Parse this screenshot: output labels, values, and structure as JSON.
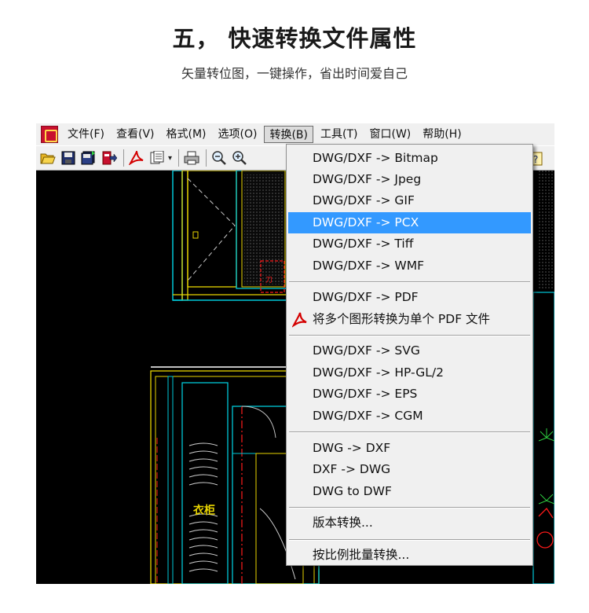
{
  "heading": {
    "title": "五， 快速转换文件属性",
    "subtitle": "矢量转位图，一键操作，省出时间爱自己"
  },
  "menubar": {
    "items": [
      {
        "label": "文件(F)"
      },
      {
        "label": "查看(V)"
      },
      {
        "label": "格式(M)"
      },
      {
        "label": "选项(O)"
      },
      {
        "label": "转换(B)",
        "active": true
      },
      {
        "label": "工具(T)"
      },
      {
        "label": "窗口(W)"
      },
      {
        "label": "帮助(H)"
      }
    ]
  },
  "toolbar": {
    "icons": [
      "open-folder-icon",
      "save-icon",
      "save-all-icon",
      "export-icon",
      "pdf-icon",
      "copy-icon",
      "print-icon",
      "zoom-out-icon",
      "zoom-in-icon"
    ],
    "dropdown_arrow": "▾"
  },
  "convert_menu": {
    "items": [
      {
        "label": "DWG/DXF -> Bitmap"
      },
      {
        "label": "DWG/DXF -> Jpeg"
      },
      {
        "label": "DWG/DXF -> GIF"
      },
      {
        "label": "DWG/DXF -> PCX",
        "highlighted": true
      },
      {
        "label": "DWG/DXF -> Tiff"
      },
      {
        "label": "DWG/DXF -> WMF"
      },
      {
        "label": "DWG/DXF -> PDF"
      },
      {
        "label": "将多个图形转换为单个 PDF 文件",
        "icon": "pdf-icon"
      },
      {
        "label": "DWG/DXF -> SVG"
      },
      {
        "label": "DWG/DXF -> HP-GL/2"
      },
      {
        "label": "DWG/DXF -> EPS"
      },
      {
        "label": "DWG/DXF -> CGM"
      },
      {
        "label": "DWG -> DXF"
      },
      {
        "label": "DXF -> DWG"
      },
      {
        "label": "DWG to DWF"
      },
      {
        "label": "版本转换..."
      },
      {
        "label": "按比例批量转换..."
      }
    ]
  },
  "canvas": {
    "label": "衣柜"
  },
  "colors": {
    "highlight": "#3399ff",
    "drawing_bg": "#000000",
    "cyan": "#00c8d8",
    "yellow": "#e8d400",
    "red": "#ff1a1a"
  }
}
